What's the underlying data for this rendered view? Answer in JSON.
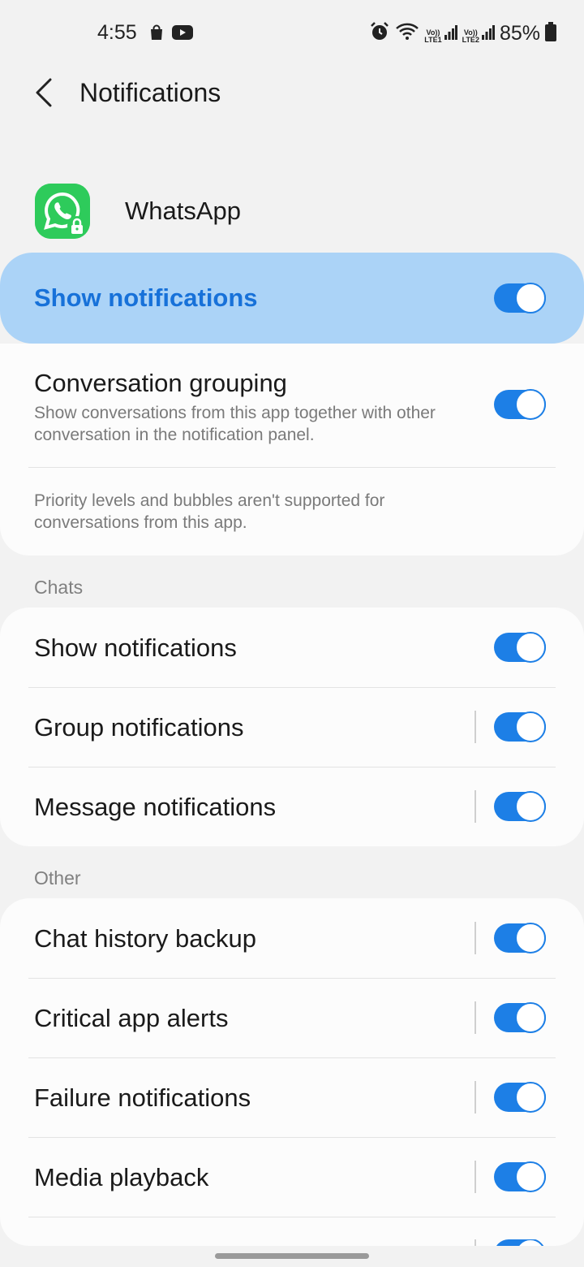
{
  "status_bar": {
    "time": "4:55",
    "battery": "85%",
    "sim1": "LTE1",
    "sim2": "LTE2",
    "volte": "Vo))"
  },
  "header": {
    "title": "Notifications"
  },
  "app": {
    "name": "WhatsApp"
  },
  "master": {
    "label": "Show notifications",
    "on": true
  },
  "conversation": {
    "title": "Conversation grouping",
    "subtitle": "Show conversations from this app together with other conversation in the notification panel.",
    "note": "Priority levels and bubbles aren't supported for conversations from this app."
  },
  "sections": {
    "chats": {
      "label": "Chats",
      "items": [
        {
          "label": "Show notifications",
          "on": true
        },
        {
          "label": "Group notifications",
          "on": true
        },
        {
          "label": "Message notifications",
          "on": true
        }
      ]
    },
    "other": {
      "label": "Other",
      "items": [
        {
          "label": "Chat history backup",
          "on": true
        },
        {
          "label": "Critical app alerts",
          "on": true
        },
        {
          "label": "Failure notifications",
          "on": true
        },
        {
          "label": "Media playback",
          "on": true
        }
      ]
    }
  },
  "colors": {
    "accent": "#1d7fe6",
    "highlight": "#abd3f7",
    "highlight_text": "#1771d9",
    "whatsapp_green": "#2ecb5b"
  }
}
